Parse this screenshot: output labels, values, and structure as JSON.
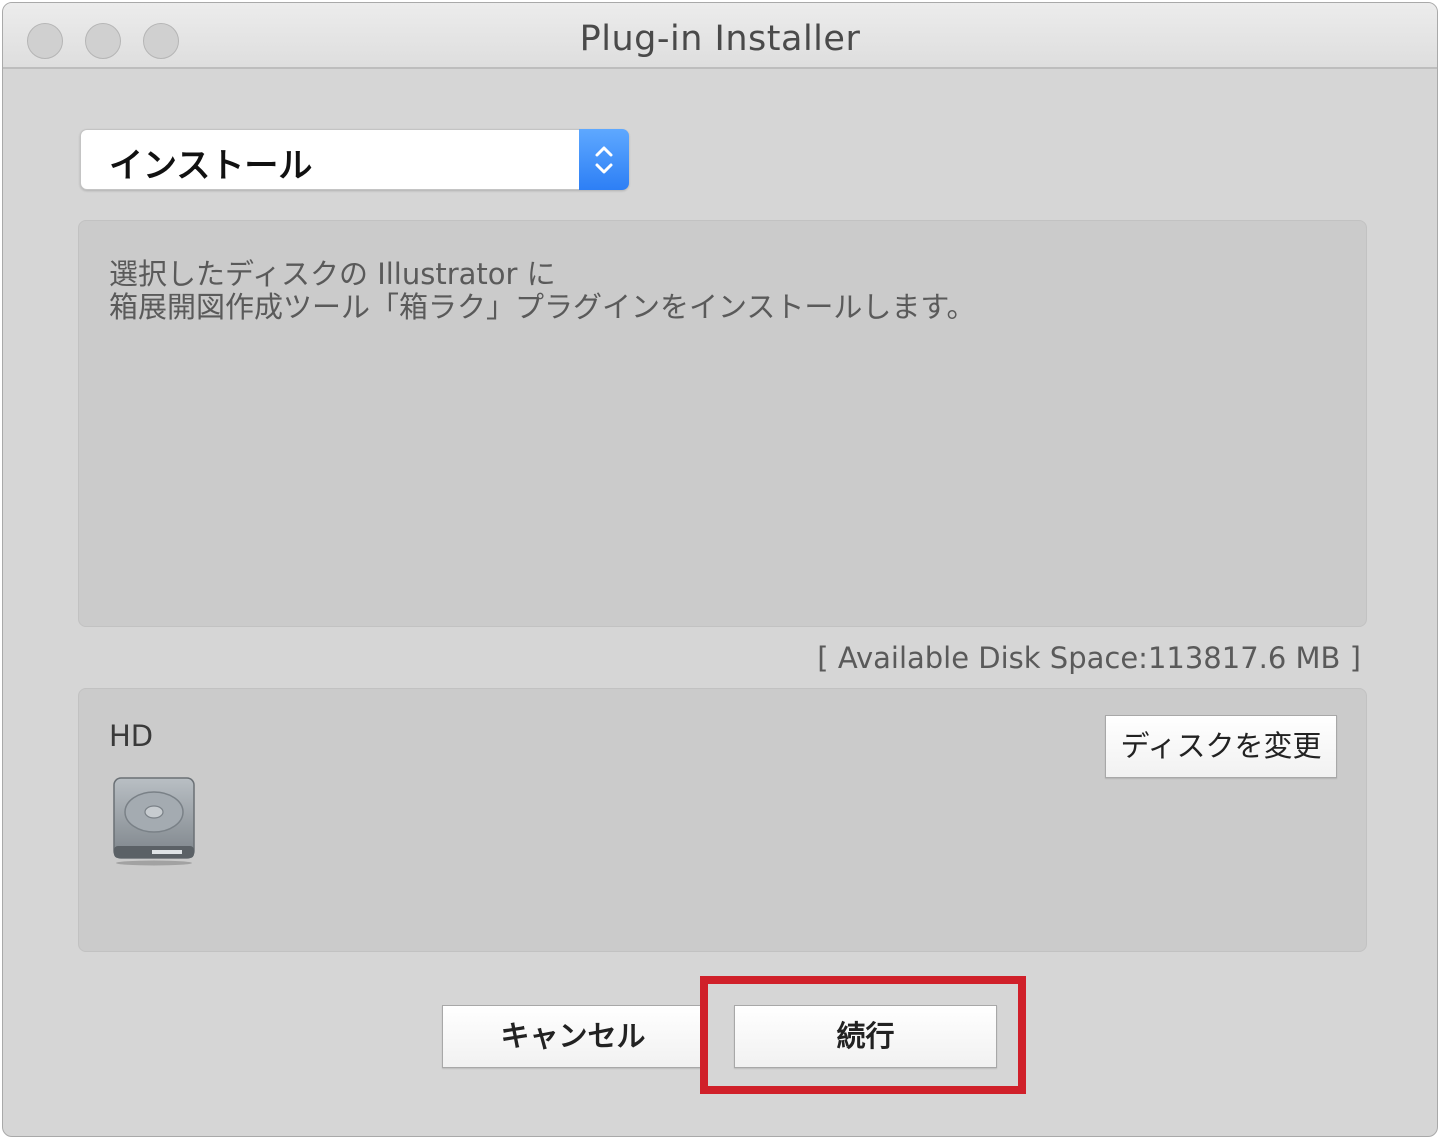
{
  "window": {
    "title": "Plug-in Installer"
  },
  "popup": {
    "selected": "インストール"
  },
  "description": {
    "line1": "選択したディスクの Illustrator に",
    "line2": "箱展開図作成ツール「箱ラク」プラグインをインストールします。"
  },
  "disk_space": "[ Available Disk Space:113817.6 MB ]",
  "disk": {
    "name": "HD",
    "change_label": "ディスクを変更"
  },
  "buttons": {
    "cancel": "キャンセル",
    "continue": "続行"
  },
  "colors": {
    "highlight": "#d0202a",
    "popup_accent": "#2d7ff5"
  },
  "icons": {
    "disk": "hard-drive-icon",
    "popup": "chevron-up-down-icon"
  }
}
